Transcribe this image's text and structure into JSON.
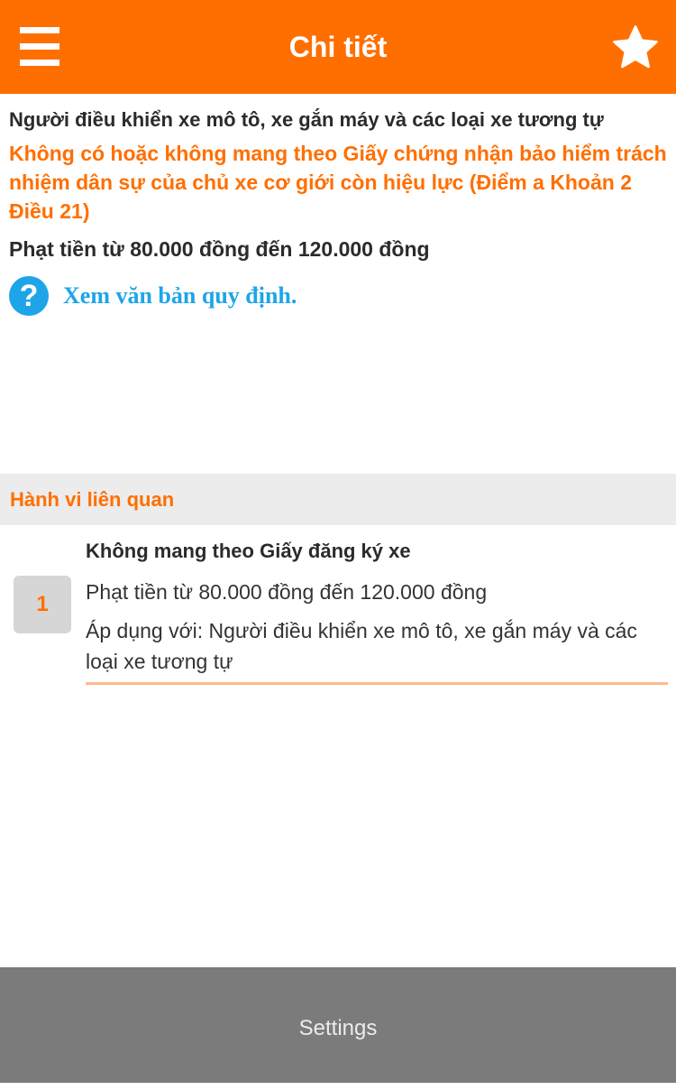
{
  "header": {
    "title": "Chi tiết",
    "menu_icon": "hamburger-menu-icon",
    "favorite_icon": "star-icon",
    "background_color": "#ff6f00"
  },
  "detail": {
    "subject": "Người điều khiển xe mô tô, xe gắn máy và các loại xe tương tự",
    "violation": "Không có hoặc không mang theo Giấy chứng nhận bảo hiểm trách nhiệm dân sự của chủ xe cơ giới còn hiệu lực (Điểm a Khoản 2 Điều 21)",
    "penalty": "Phạt tiền từ 80.000 đồng đến 120.000 đồng",
    "view_link_icon": "help-icon",
    "view_link_label": "Xem văn bản quy định."
  },
  "related": {
    "title": "Hành vi liên quan",
    "items": [
      {
        "index": "1",
        "title": "Không mang theo Giấy đăng ký xe",
        "penalty": "Phạt tiền từ 80.000 đồng đến 120.000 đồng",
        "applies": "Áp dụng với: Người điều khiển xe mô tô, xe gắn máy và các loại xe tương tự"
      }
    ]
  },
  "bottom": {
    "label": "Settings"
  },
  "colors": {
    "accent": "#ff6f00",
    "link": "#1ea5e8",
    "section_background": "#ececec",
    "bottom_bar": "#7b7b7b"
  }
}
